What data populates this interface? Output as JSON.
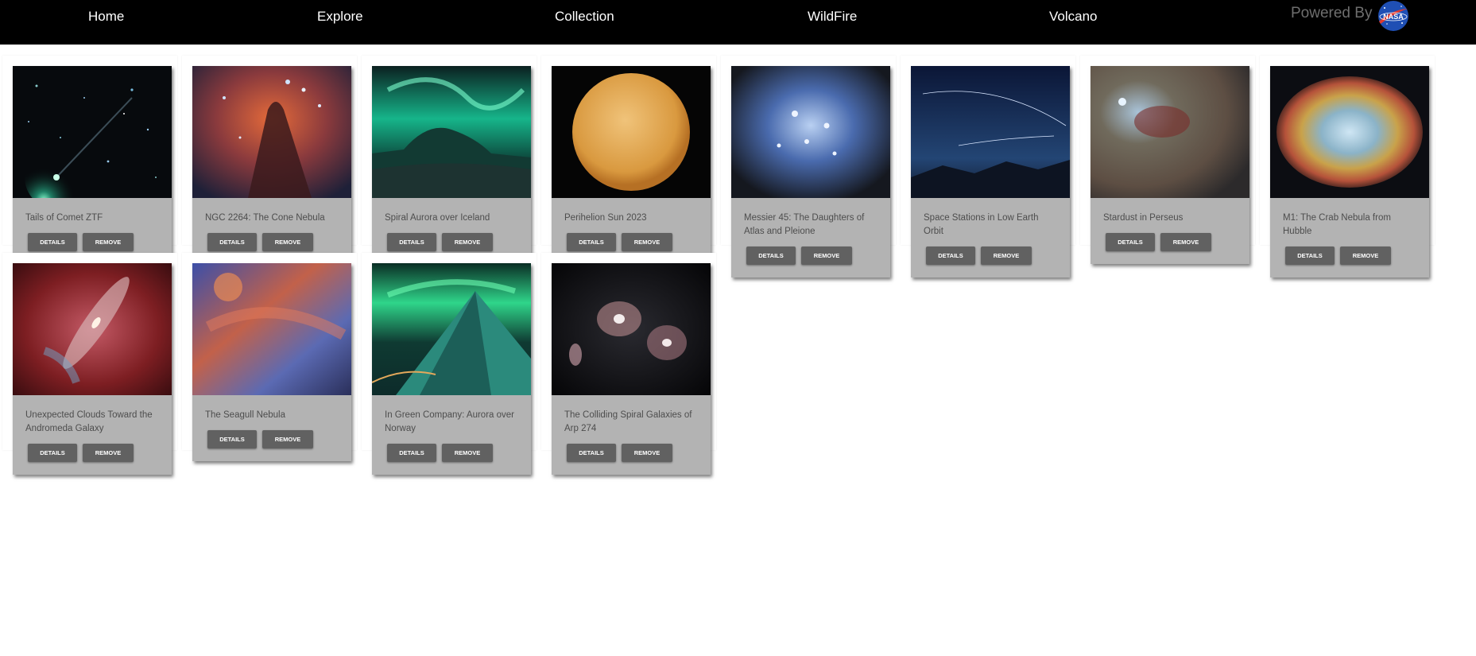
{
  "nav": {
    "items": [
      "Home",
      "Explore",
      "Collection",
      "WildFire",
      "Volcano"
    ],
    "powered_by": "Powered By"
  },
  "button_labels": {
    "details": "DETAILS",
    "remove": "REMOVE"
  },
  "cards": [
    {
      "title": "Tails of Comet ZTF"
    },
    {
      "title": "NGC 2264: The Cone Nebula"
    },
    {
      "title": "Spiral Aurora over Iceland"
    },
    {
      "title": "Perihelion Sun 2023"
    },
    {
      "title": "Messier 45: The Daughters of Atlas and Pleione"
    },
    {
      "title": "Space Stations in Low Earth Orbit"
    },
    {
      "title": "Stardust in Perseus"
    },
    {
      "title": "M1: The Crab Nebula from Hubble"
    },
    {
      "title": "Unexpected Clouds Toward the Andromeda Galaxy"
    },
    {
      "title": "The Seagull Nebula"
    },
    {
      "title": "In Green Company: Aurora over Norway"
    },
    {
      "title": "The Colliding Spiral Galaxies of Arp 274"
    }
  ],
  "colors": {
    "navbar_bg": "#000000",
    "card_bg": "#b3b3b3",
    "button_bg": "#616161",
    "powered_by_text": "#6e6e6e"
  }
}
